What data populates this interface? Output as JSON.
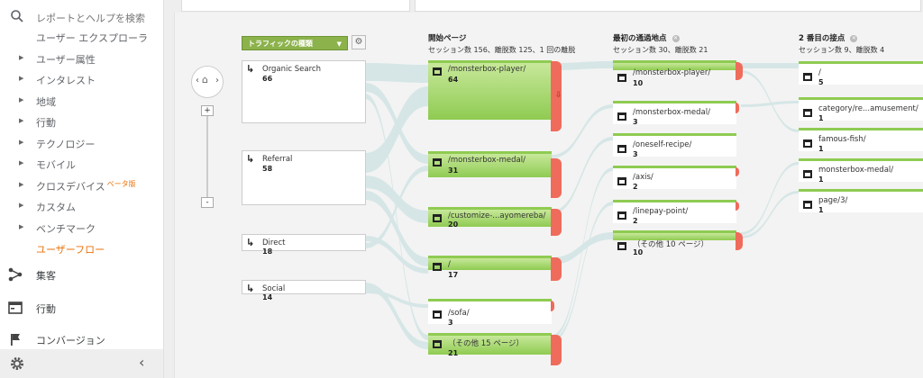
{
  "sidebar": {
    "search_placeholder": "レポートとヘルプを検索",
    "items": [
      {
        "label": "ユーザー エクスプローラ",
        "arrow": ""
      },
      {
        "label": "ユーザー属性",
        "arrow": "▶"
      },
      {
        "label": "インタレスト",
        "arrow": "▶"
      },
      {
        "label": "地域",
        "arrow": "▶"
      },
      {
        "label": "行動",
        "arrow": "▶"
      },
      {
        "label": "テクノロジー",
        "arrow": "▶"
      },
      {
        "label": "モバイル",
        "arrow": "▶"
      },
      {
        "label": "クロスデバイス",
        "arrow": "▶",
        "badge": "ベータ版"
      },
      {
        "label": "カスタム",
        "arrow": "▶"
      },
      {
        "label": "ベンチマーク",
        "arrow": "▶"
      },
      {
        "label": "ユーザーフロー",
        "arrow": ""
      }
    ],
    "main_sections": [
      {
        "label": "集客",
        "icon": "acquisition-icon"
      },
      {
        "label": "行動",
        "icon": "behavior-icon"
      },
      {
        "label": "コンバージョン",
        "icon": "flag-icon"
      }
    ],
    "collapse_label": "‹"
  },
  "controls": {
    "dimension_button": "トラフィックの種類",
    "settings_icon": "⚙",
    "zoom_in": "+",
    "zoom_out": "-"
  },
  "columns": [
    {
      "title": "開始ページ",
      "subtitle": "セッション数 156、離脱数 125、1 回の離脱"
    },
    {
      "title": "最初の通過地点",
      "subtitle": "セッション数 30、離脱数 21"
    },
    {
      "title": "2 番目の接点",
      "subtitle": "セッション数 9、離脱数 4"
    }
  ],
  "sources": [
    {
      "name": "Organic Search",
      "count": "66"
    },
    {
      "name": "Referral",
      "count": "58"
    },
    {
      "name": "Direct",
      "count": "18"
    },
    {
      "name": "Social",
      "count": "14"
    }
  ],
  "start_pages": [
    {
      "name": "/monsterbox-player/",
      "count": "64"
    },
    {
      "name": "/monsterbox-medal/",
      "count": "31"
    },
    {
      "name": "/customize-...ayomereba/",
      "count": "20"
    },
    {
      "name": "/",
      "count": "17"
    },
    {
      "name": "/sofa/",
      "count": "3"
    },
    {
      "name": "（その他 15 ページ）",
      "count": "21"
    }
  ],
  "first_interaction": [
    {
      "name": "/monsterbox-player/",
      "count": "10"
    },
    {
      "name": "/monsterbox-medal/",
      "count": "3"
    },
    {
      "name": "/oneself-recipe/",
      "count": "3"
    },
    {
      "name": "/axis/",
      "count": "2"
    },
    {
      "name": "/linepay-point/",
      "count": "2"
    },
    {
      "name": "（その他 10 ページ）",
      "count": "10"
    }
  ],
  "second_interaction": [
    {
      "name": "/",
      "count": "5"
    },
    {
      "name": "category/re...amusement/",
      "count": "1"
    },
    {
      "name": "famous-fish/",
      "count": "1"
    },
    {
      "name": "monsterbox-medal/",
      "count": "1"
    },
    {
      "name": "page/3/",
      "count": "1"
    }
  ],
  "colors": {
    "node_green": "#8fcb52",
    "dropoff_red": "#ef6b5b",
    "flow_link": "#d2e4e4",
    "accent_orange": "#e8710a",
    "button_green": "#8cb24b"
  }
}
